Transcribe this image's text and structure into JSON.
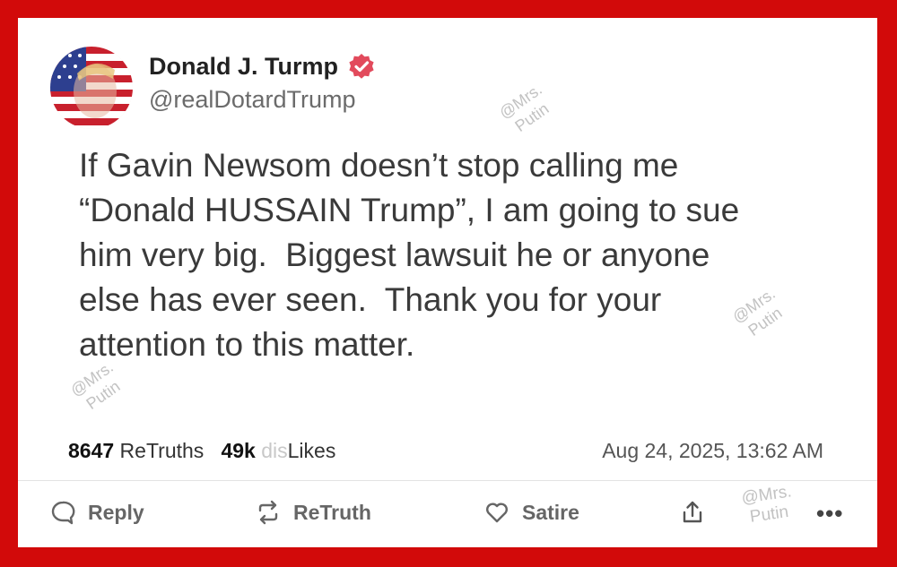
{
  "post": {
    "display_name": "Donald J. Turmp",
    "handle": "@realDotardTrump",
    "text": "If Gavin Newsom doesn’t stop calling me\n“Donald HUSSAIN Trump”, I am going to sue\nhim very big.  Biggest lawsuit he or anyone\nelse has ever seen.  Thank you for your\nattention to this matter.",
    "retruths_count": "8647",
    "retruths_label": " ReTruths",
    "likes_count": "49k",
    "likes_prefix": "dis",
    "likes_label": "Likes",
    "timestamp": "Aug 24, 2025, 13:62 AM"
  },
  "actions": {
    "reply": "Reply",
    "retruth": "ReTruth",
    "like": "Satire",
    "more": "•••"
  },
  "watermark": {
    "line1": "@Mrs.",
    "line2": "Putin"
  },
  "colors": {
    "frame": "#d20a0a",
    "verified": "#e24a5c"
  },
  "icons": [
    "avatar",
    "verified-badge-icon",
    "reply-icon",
    "retruth-icon",
    "heart-icon",
    "share-icon",
    "more-icon"
  ]
}
